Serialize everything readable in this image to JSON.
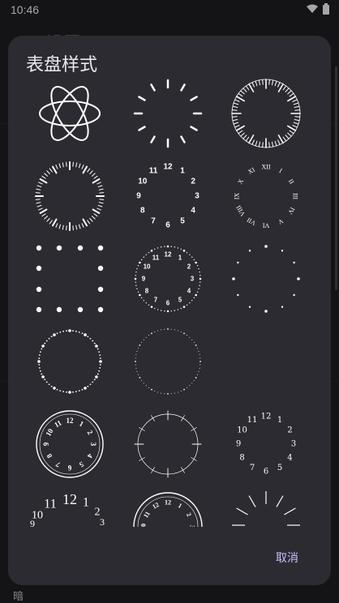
{
  "status": {
    "time": "10:46"
  },
  "background": {
    "title": "设置",
    "bottom_text": "暗"
  },
  "dialog": {
    "title": "表盘样式",
    "cancel_label": "取消",
    "faces": [
      {
        "id": "atom"
      },
      {
        "id": "ticks-12"
      },
      {
        "id": "ticks-60"
      },
      {
        "id": "ticks-60-thin"
      },
      {
        "id": "numbers-bold"
      },
      {
        "id": "roman"
      },
      {
        "id": "dots-square"
      },
      {
        "id": "numbers-dots-ring"
      },
      {
        "id": "dots-sparse"
      },
      {
        "id": "dots-ring"
      },
      {
        "id": "dots-ring-fine"
      },
      {
        "id": "empty"
      },
      {
        "id": "circle-numbers"
      },
      {
        "id": "crosshair-ring"
      },
      {
        "id": "serif-numbers"
      },
      {
        "id": "serif-numbers-large"
      },
      {
        "id": "arc-numbers"
      },
      {
        "id": "rays"
      }
    ],
    "numerals": [
      "12",
      "1",
      "2",
      "3",
      "4",
      "5",
      "6",
      "7",
      "8",
      "9",
      "10",
      "11"
    ],
    "roman": [
      "XII",
      "I",
      "II",
      "III",
      "IV",
      "V",
      "VI",
      "VII",
      "VIII",
      "IX",
      "X",
      "XI"
    ]
  },
  "colors": {
    "dialog_bg": "#2c2b31",
    "accent": "#cdbcff",
    "face": "#ffffff"
  }
}
